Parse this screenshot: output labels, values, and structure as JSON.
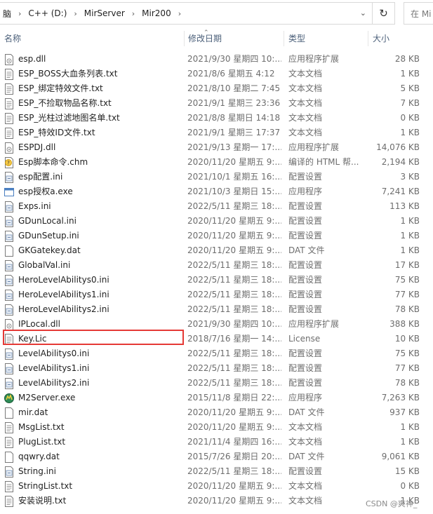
{
  "breadcrumb": [
    "脑",
    "C++ (D:)",
    "MirServer",
    "Mir200"
  ],
  "search_placeholder": "在 Mi",
  "columns": {
    "name": "名称",
    "date": "修改日期",
    "type": "类型",
    "size": "大小"
  },
  "files": [
    {
      "name": "esp.dll",
      "date": "2021/9/30 星期四 10:...",
      "type": "应用程序扩展",
      "size": "28 KB",
      "icon": "dll-icon"
    },
    {
      "name": "ESP_BOSS大血条列表.txt",
      "date": "2021/8/6 星期五 4:12",
      "type": "文本文档",
      "size": "1 KB",
      "icon": "text-file-icon"
    },
    {
      "name": "ESP_绑定特效文件.txt",
      "date": "2021/8/10 星期二 7:45",
      "type": "文本文档",
      "size": "5 KB",
      "icon": "text-file-icon"
    },
    {
      "name": "ESP_不捡取物品名称.txt",
      "date": "2021/9/1 星期三 23:36",
      "type": "文本文档",
      "size": "7 KB",
      "icon": "text-file-icon"
    },
    {
      "name": "ESP_光柱过滤地图名单.txt",
      "date": "2021/8/8 星期日 14:18",
      "type": "文本文档",
      "size": "0 KB",
      "icon": "text-file-icon"
    },
    {
      "name": "ESP_特效ID文件.txt",
      "date": "2021/9/1 星期三 17:37",
      "type": "文本文档",
      "size": "1 KB",
      "icon": "text-file-icon"
    },
    {
      "name": "ESPDJ.dll",
      "date": "2021/9/13 星期一 17:...",
      "type": "应用程序扩展",
      "size": "14,076 KB",
      "icon": "dll-icon"
    },
    {
      "name": "Esp脚本命令.chm",
      "date": "2020/11/20 星期五 9:...",
      "type": "编译的 HTML 帮...",
      "size": "2,194 KB",
      "icon": "chm-help-icon"
    },
    {
      "name": "esp配置.ini",
      "date": "2021/10/1 星期五 16:...",
      "type": "配置设置",
      "size": "3 KB",
      "icon": "ini-file-icon"
    },
    {
      "name": "esp授权a.exe",
      "date": "2021/10/3 星期日 15:...",
      "type": "应用程序",
      "size": "7,241 KB",
      "icon": "exe-window-icon"
    },
    {
      "name": "Exps.ini",
      "date": "2022/5/11 星期三 18:...",
      "type": "配置设置",
      "size": "113 KB",
      "icon": "ini-file-icon"
    },
    {
      "name": "GDunLocal.ini",
      "date": "2020/11/20 星期五 9:...",
      "type": "配置设置",
      "size": "1 KB",
      "icon": "ini-file-icon"
    },
    {
      "name": "GDunSetup.ini",
      "date": "2020/11/20 星期五 9:...",
      "type": "配置设置",
      "size": "1 KB",
      "icon": "ini-file-icon"
    },
    {
      "name": "GKGatekey.dat",
      "date": "2020/11/20 星期五 9:...",
      "type": "DAT 文件",
      "size": "1 KB",
      "icon": "blank-file-icon"
    },
    {
      "name": "GlobalVal.ini",
      "date": "2022/5/11 星期三 18:...",
      "type": "配置设置",
      "size": "17 KB",
      "icon": "ini-file-icon"
    },
    {
      "name": "HeroLevelAbilitys0.ini",
      "date": "2022/5/11 星期三 18:...",
      "type": "配置设置",
      "size": "75 KB",
      "icon": "ini-file-icon"
    },
    {
      "name": "HeroLevelAbilitys1.ini",
      "date": "2022/5/11 星期三 18:...",
      "type": "配置设置",
      "size": "77 KB",
      "icon": "ini-file-icon"
    },
    {
      "name": "HeroLevelAbilitys2.ini",
      "date": "2022/5/11 星期三 18:...",
      "type": "配置设置",
      "size": "78 KB",
      "icon": "ini-file-icon"
    },
    {
      "name": "IPLocal.dll",
      "date": "2021/9/30 星期四 10:...",
      "type": "应用程序扩展",
      "size": "388 KB",
      "icon": "dll-icon"
    },
    {
      "name": "Key.Lic",
      "date": "2018/7/16 星期一 14:...",
      "type": "License",
      "size": "10 KB",
      "icon": "text-file-icon"
    },
    {
      "name": "LevelAbilitys0.ini",
      "date": "2022/5/11 星期三 18:...",
      "type": "配置设置",
      "size": "75 KB",
      "icon": "ini-file-icon"
    },
    {
      "name": "LevelAbilitys1.ini",
      "date": "2022/5/11 星期三 18:...",
      "type": "配置设置",
      "size": "77 KB",
      "icon": "ini-file-icon"
    },
    {
      "name": "LevelAbilitys2.ini",
      "date": "2022/5/11 星期三 18:...",
      "type": "配置设置",
      "size": "78 KB",
      "icon": "ini-file-icon"
    },
    {
      "name": "M2Server.exe",
      "date": "2015/11/8 星期日 22:...",
      "type": "应用程序",
      "size": "7,263 KB",
      "icon": "m2server-exe-icon"
    },
    {
      "name": "mir.dat",
      "date": "2020/11/20 星期五 9:...",
      "type": "DAT 文件",
      "size": "937 KB",
      "icon": "blank-file-icon"
    },
    {
      "name": "MsgList.txt",
      "date": "2020/11/20 星期五 9:...",
      "type": "文本文档",
      "size": "1 KB",
      "icon": "text-file-icon"
    },
    {
      "name": "PlugList.txt",
      "date": "2021/11/4 星期四 16:...",
      "type": "文本文档",
      "size": "1 KB",
      "icon": "text-file-icon"
    },
    {
      "name": "qqwry.dat",
      "date": "2015/7/26 星期日 20:...",
      "type": "DAT 文件",
      "size": "9,061 KB",
      "icon": "blank-file-icon"
    },
    {
      "name": "String.ini",
      "date": "2022/5/11 星期三 18:...",
      "type": "配置设置",
      "size": "15 KB",
      "icon": "ini-file-icon"
    },
    {
      "name": "StringList.txt",
      "date": "2020/11/20 星期五 9:...",
      "type": "文本文档",
      "size": "0 KB",
      "icon": "text-file-icon"
    },
    {
      "name": "安装说明.txt",
      "date": "2020/11/20 星期五 9:...",
      "type": "文本文档",
      "size": "1 KB",
      "icon": "text-file-icon"
    }
  ],
  "highlighted_file": "Key.Lic",
  "highlight_color": "#e53935",
  "watermark": "CSDN @爽神_"
}
